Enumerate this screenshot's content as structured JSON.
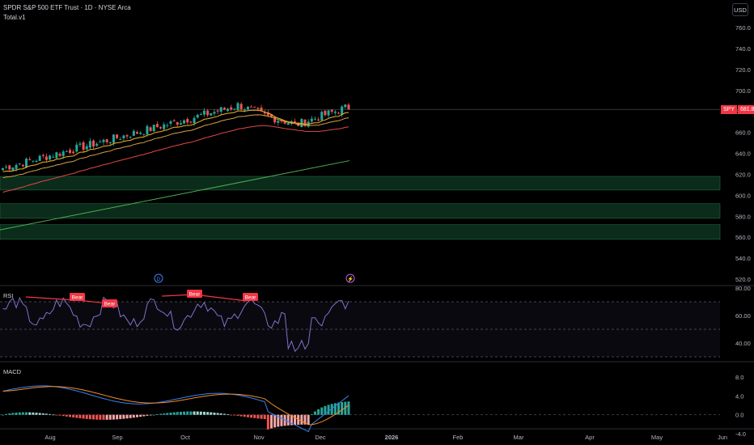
{
  "header": {
    "title": "SPDR S&P 500 ETF Trust · 1D · NYSE Arca",
    "indicator": "Total.v1",
    "currency_button": "USD"
  },
  "price_tag": {
    "symbol": "SPY",
    "value": "681.8"
  },
  "panes": {
    "rsi_label": "RSI",
    "macd_label": "MACD"
  },
  "colors": {
    "background": "#000000",
    "up": "#26a69a",
    "down": "#ef5350",
    "ema_fast": "#f0b429",
    "ema_mid": "#d4a04a",
    "ema_slow": "#e04848",
    "sma_long": "#4caf50",
    "zone": "#0f3a24",
    "rsi": "#7e73c9",
    "macd": "#3b82f6",
    "signal": "#f28c28",
    "bear_label": "#f23645"
  },
  "chart_data": {
    "type": "candlestick",
    "price_axis": {
      "ticks": [
        "760.0",
        "740.0",
        "720.0",
        "700.0",
        "680.0",
        "660.0",
        "640.0",
        "620.0",
        "600.0",
        "580.0",
        "560.0",
        "540.0",
        "520.0"
      ],
      "range": [
        515,
        770
      ]
    },
    "time_axis": [
      "Aug",
      "Sep",
      "Oct",
      "Nov",
      "Dec",
      "2026",
      "Feb",
      "Mar",
      "Apr",
      "May",
      "Jun"
    ],
    "last_close": 681.8,
    "support_zones": [
      [
        605,
        618
      ],
      [
        578,
        592
      ],
      [
        558,
        572
      ]
    ],
    "rsi": {
      "ticks": [
        "80.00",
        "60.00",
        "40.00"
      ],
      "levels": [
        70,
        50,
        30
      ],
      "divergence_labels": [
        "Bear",
        "Bear",
        "Bear",
        "Bear"
      ]
    },
    "macd": {
      "ticks": [
        "8.0",
        "4.0",
        "0.0",
        "-4.0"
      ],
      "range": [
        -4.5,
        9.5
      ]
    },
    "event_markers": [
      "D",
      "⚡"
    ]
  }
}
